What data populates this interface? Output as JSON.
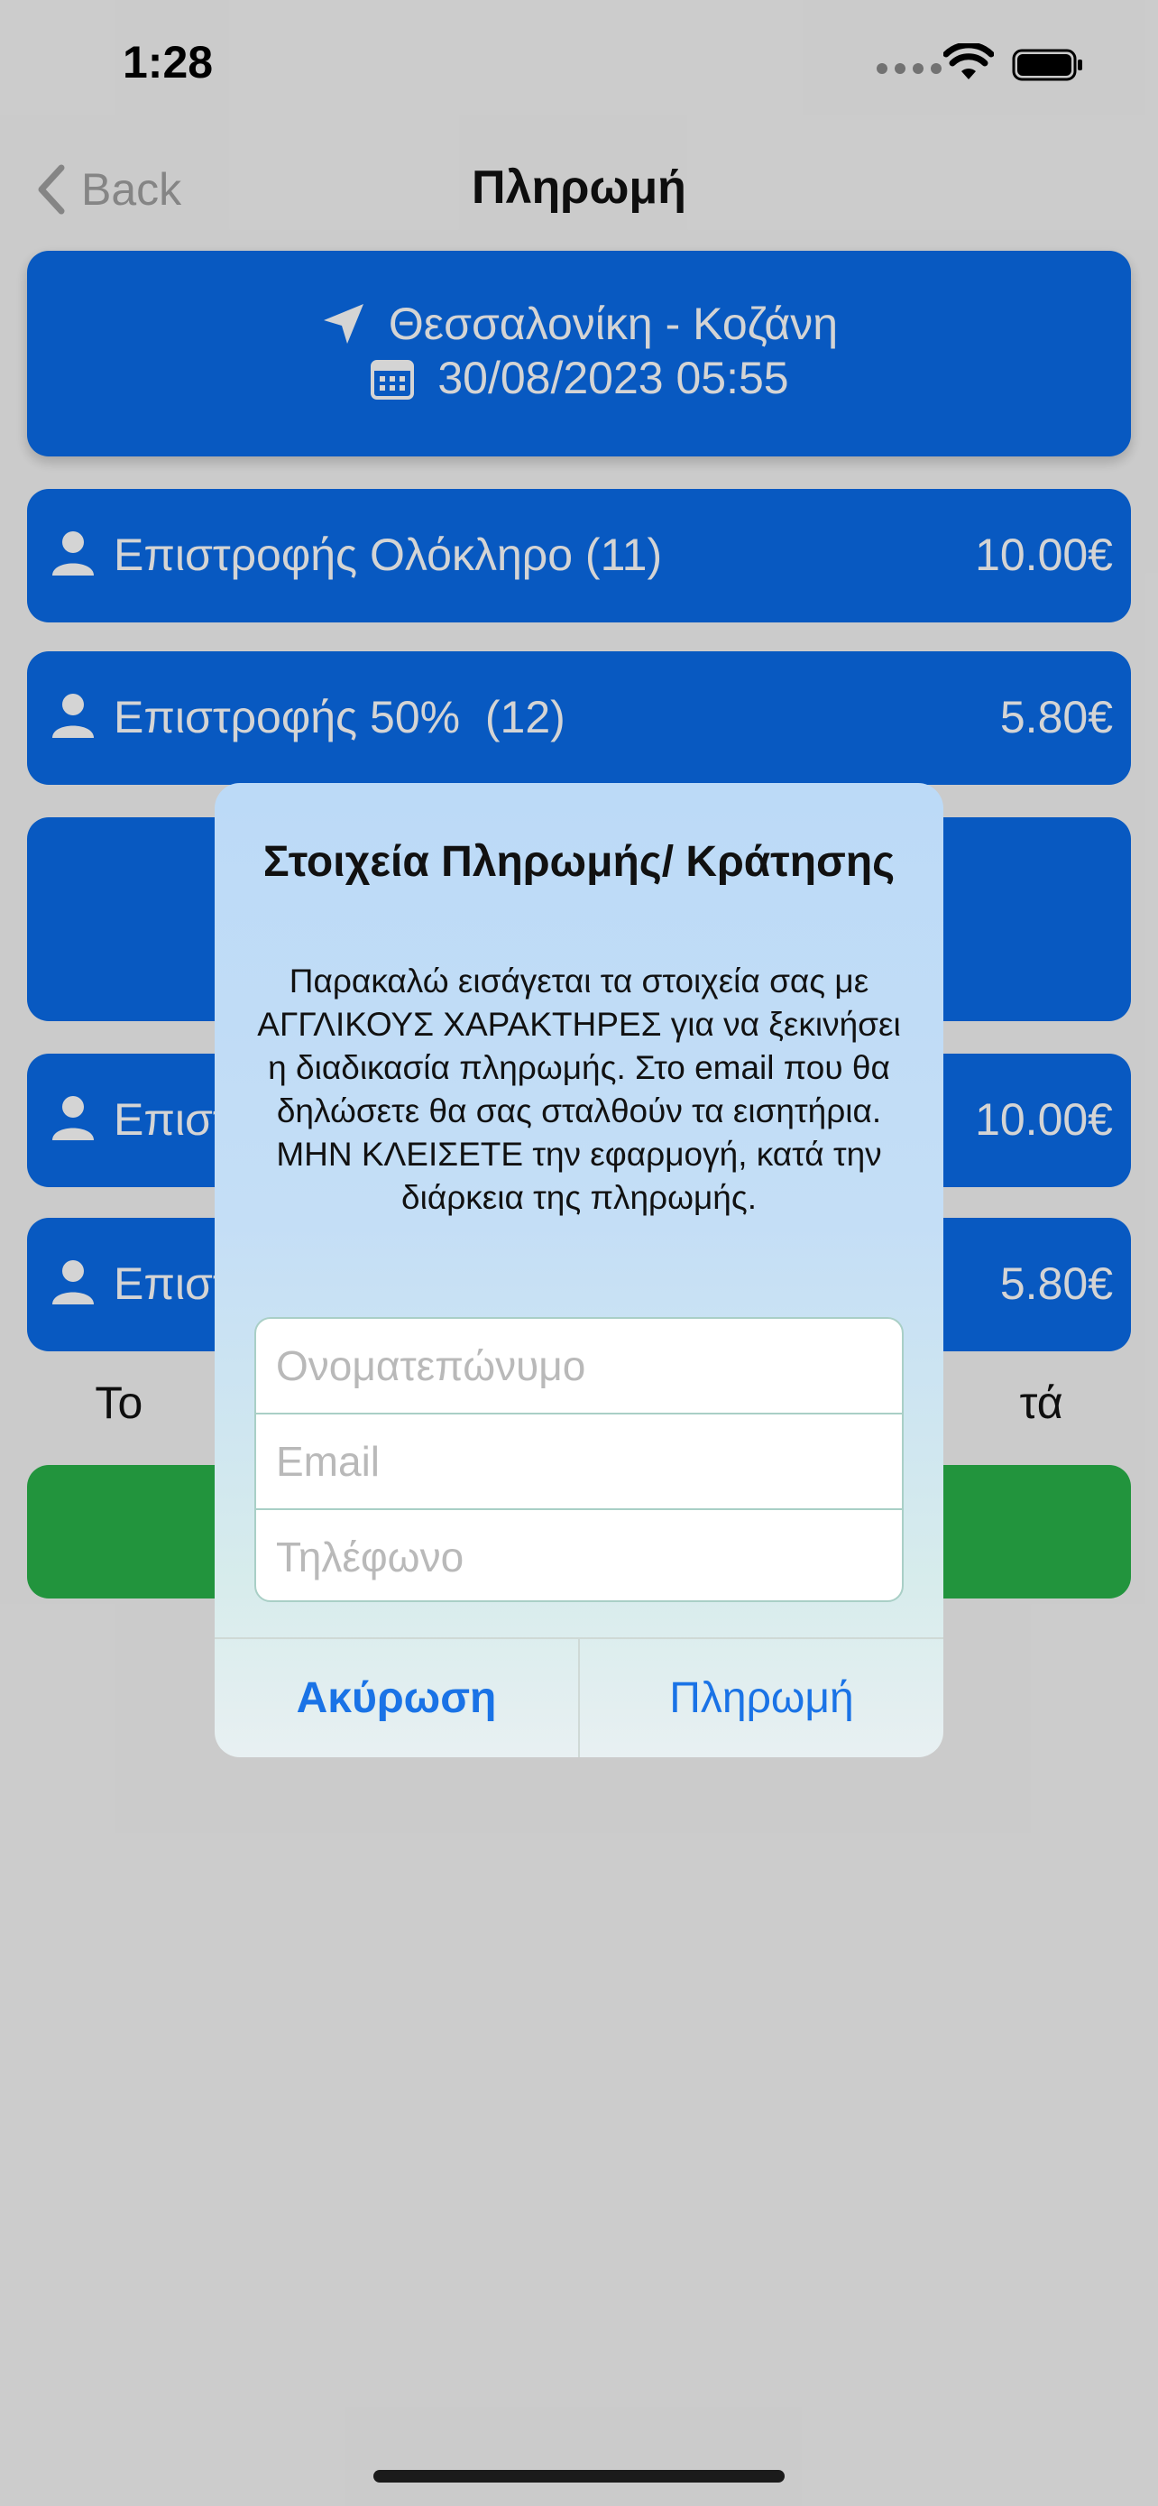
{
  "status": {
    "time": "1:28"
  },
  "nav": {
    "back_label": "Back",
    "title": "Πληρωμή"
  },
  "route": {
    "trip": "Θεσσαλονίκη - Κοζάνη",
    "datetime": "30/08/2023 05:55"
  },
  "tickets": [
    {
      "label": "Επιστροφής Ολόκληρο (11)",
      "price": "10.00€"
    },
    {
      "label": "Επιστροφής 50%  (12)",
      "price": "5.80€"
    },
    {
      "label": "Επιστ",
      "price": "10.00€"
    },
    {
      "label": "Επιστ",
      "price": "5.80€"
    }
  ],
  "total_text": "Το                                                                      τά",
  "alert": {
    "title": "Στοιχεία Πληρωμής/ Κράτησης",
    "message": "Παρακαλώ εισάγεται τα στοιχεία σας με ΑΓΓΛΙΚΟΥΣ ΧΑΡΑΚΤΗΡΕΣ για να ξεκινήσει η διαδικασία πληρωμής. Στο email που θα δηλώσετε θα σας σταλθούν τα εισητήρια. ΜΗΝ ΚΛΕΙΣΕΤΕ την εφαρμογή, κατά την διάρκεια της πληρωμής.",
    "fields": {
      "name_placeholder": "Ονοματεπώνυμο",
      "email_placeholder": "Email",
      "phone_placeholder": "Τηλέφωνο"
    },
    "cancel_label": "Ακύρωση",
    "pay_label": "Πληρωμή"
  },
  "colors": {
    "card_blue": "#0a6ce8",
    "pay_green": "#2ab34a",
    "link_blue": "#1a73e6"
  },
  "icons": [
    "back-chevron-icon",
    "location-arrow-icon",
    "calendar-icon",
    "person-icon",
    "wifi-icon",
    "battery-icon",
    "signal-icon"
  ]
}
